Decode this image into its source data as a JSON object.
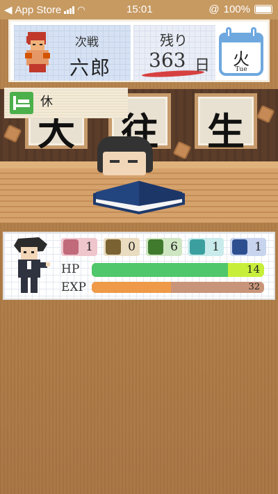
{
  "status_bar": {
    "back_label": "App Store",
    "time": "15:01",
    "battery": "100%"
  },
  "header": {
    "next_label": "次戦",
    "next_opponent": "六郎",
    "remaining_label": "残り",
    "remaining_days": "363",
    "remaining_unit": "日",
    "weekday_jp": "火",
    "weekday_en": "Tue"
  },
  "scene": {
    "state_label": "休",
    "scroll_chars": [
      "大",
      "往",
      "生"
    ]
  },
  "stats": {
    "items": [
      {
        "name": "strength",
        "icon": "fist-icon",
        "value": "1",
        "color": "#c06a7a"
      },
      {
        "name": "defense",
        "icon": "shield-icon",
        "value": "0",
        "color": "#7a6233"
      },
      {
        "name": "green-dice",
        "icon": "green-dice-icon",
        "value": "6",
        "color": "#3f7a2d"
      },
      {
        "name": "teal-dice",
        "icon": "teal-dice-icon",
        "value": "1",
        "color": "#3b9f9f"
      },
      {
        "name": "blue-dice",
        "icon": "blue-dice-icon",
        "value": "1",
        "color": "#2d4f8f"
      }
    ],
    "hp_label": "HP",
    "hp_value": "14",
    "hp_fraction": 0.79,
    "exp_label": "EXP",
    "exp_value": "32",
    "exp_fraction": 0.46
  },
  "colors": {
    "hp_fill": "#4fc76a",
    "hp_tail": "#c7ef3a",
    "exp_fill": "#ef9a48",
    "exp_track": "#c9957a"
  }
}
